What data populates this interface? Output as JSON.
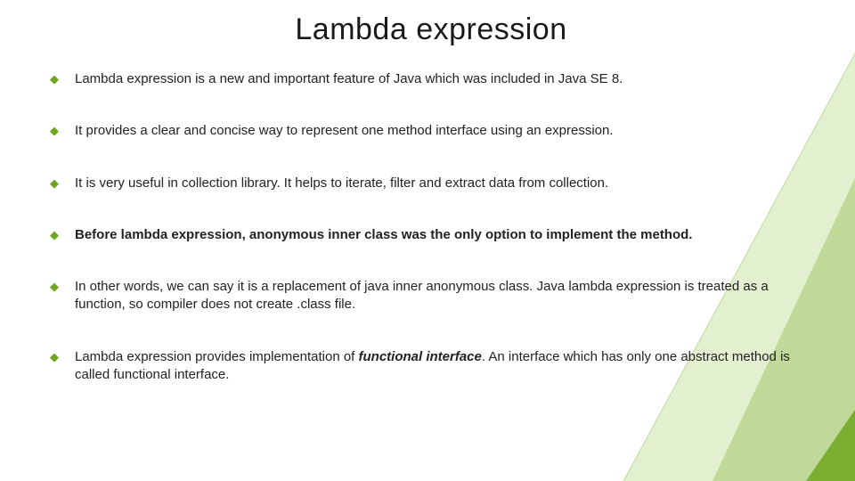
{
  "accent": "#6fa51f",
  "title": "Lambda expression",
  "bullets": [
    {
      "html": "Lambda expression is a new and important feature of Java which was included in Java SE 8."
    },
    {
      "html": "It provides a clear and concise way to represent one method interface using an expression."
    },
    {
      "html": "It is very useful in collection library. It helps to iterate, filter and extract data from collection."
    },
    {
      "html": "<span class=\"bold\">Before lambda expression, anonymous inner class was the only option to implement the method.</span>"
    },
    {
      "html": "In other words, we can say it is a replacement of java inner anonymous class. Java lambda expression is treated as a function, so compiler does not create .class file."
    },
    {
      "html": "Lambda expression provides implementation of <span class=\"fi\">functional interface</span>. An interface which has only one abstract method is called functional interface."
    }
  ]
}
